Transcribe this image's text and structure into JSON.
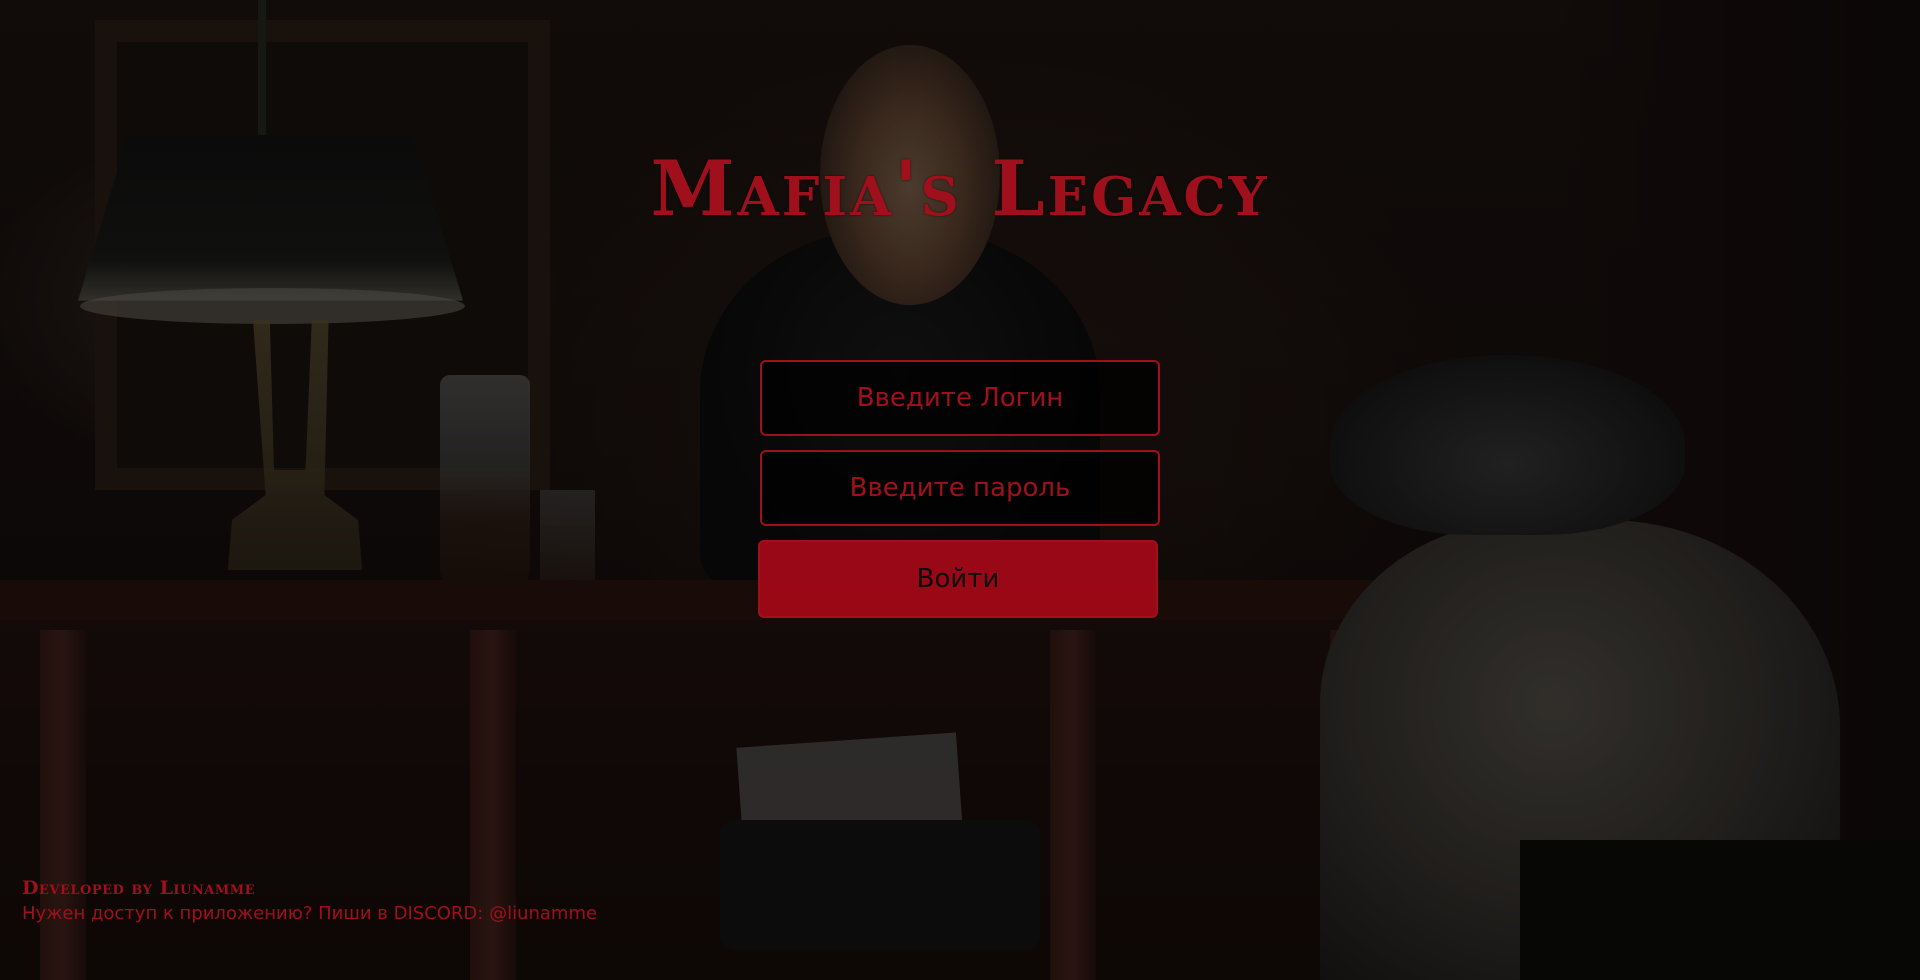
{
  "app": {
    "title": "Mafia's Legacy"
  },
  "login": {
    "username_placeholder": "Введите Логин",
    "password_placeholder": "Введите пароль",
    "submit_label": "Войти"
  },
  "footer": {
    "developer_credit": "Developed by Liunamme",
    "access_note": "Нужен доступ к приложению? Пиши в DISCORD: @liunamme"
  },
  "colors": {
    "accent": "#a0101c",
    "button_fill": "#b00818",
    "field_background": "#000000"
  }
}
